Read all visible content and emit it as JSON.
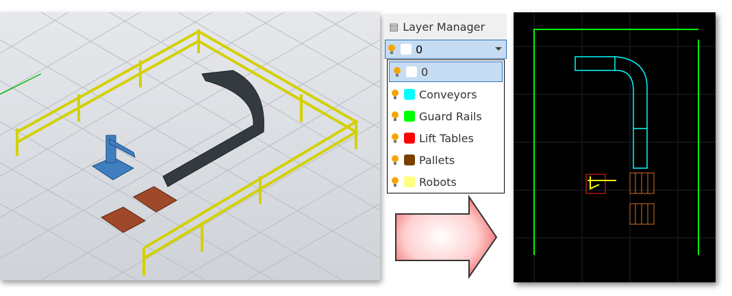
{
  "layer_manager": {
    "title": "Layer Manager",
    "selected": {
      "label": "0",
      "color": "#ffffff"
    },
    "layers": [
      {
        "label": "0",
        "color": "#ffffff"
      },
      {
        "label": "Conveyors",
        "color": "#00ffff"
      },
      {
        "label": "Guard Rails",
        "color": "#00ff00"
      },
      {
        "label": "Lift Tables",
        "color": "#ff0000"
      },
      {
        "label": "Pallets",
        "color": "#7a3f00"
      },
      {
        "label": "Robots",
        "color": "#ffff80"
      }
    ]
  }
}
